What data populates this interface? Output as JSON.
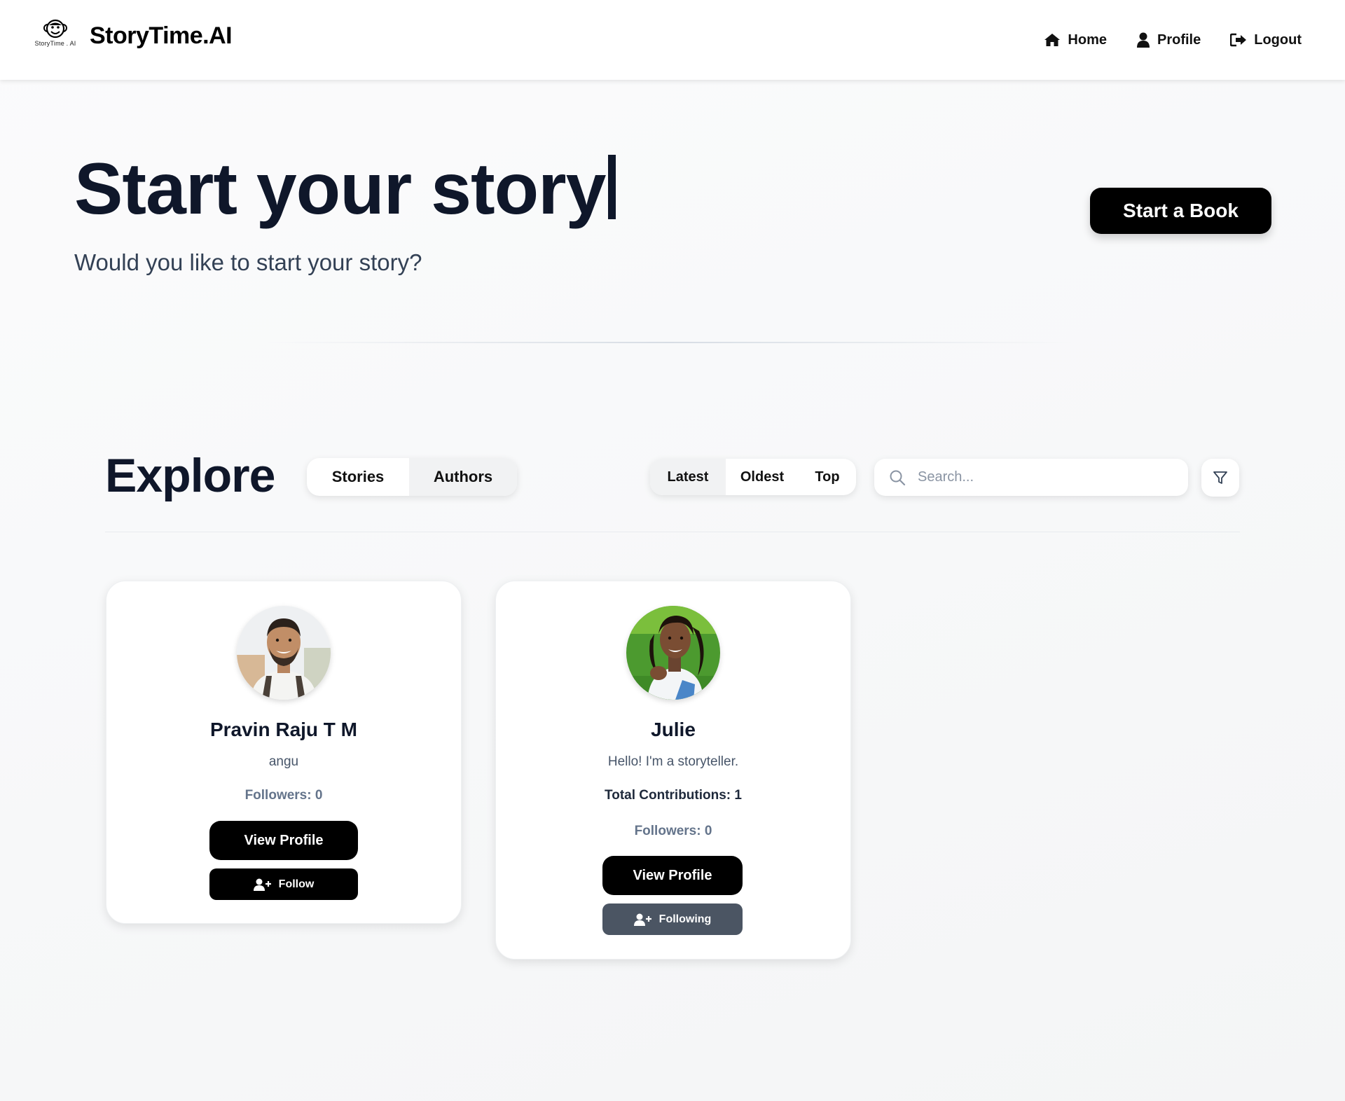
{
  "header": {
    "logo_caption": "StoryTime . AI",
    "brand": "StoryTime.AI",
    "nav": [
      {
        "label": "Home",
        "icon": "home-icon"
      },
      {
        "label": "Profile",
        "icon": "user-icon"
      },
      {
        "label": "Logout",
        "icon": "logout-icon"
      }
    ]
  },
  "hero": {
    "title": "Start your story",
    "subtitle": "Would you like to start your story?",
    "cta": "Start a Book"
  },
  "explore": {
    "title": "Explore",
    "type_tabs": [
      {
        "label": "Stories",
        "active": false
      },
      {
        "label": "Authors",
        "active": true
      }
    ],
    "sort_tabs": [
      {
        "label": "Latest",
        "active": true
      },
      {
        "label": "Oldest",
        "active": false
      },
      {
        "label": "Top",
        "active": false
      }
    ],
    "search_placeholder": "Search...",
    "filter_icon": "filter-icon"
  },
  "authors": [
    {
      "name": "Pravin Raju T M",
      "bio": "angu",
      "followers": "Followers: 0",
      "view_label": "View Profile",
      "follow_label": "Follow"
    },
    {
      "name": "Julie",
      "bio": "Hello! I'm a storyteller.",
      "contributions": "Total Contributions: 1",
      "followers": "Followers: 0",
      "view_label": "View Profile",
      "follow_label": "Following"
    }
  ],
  "colors": {
    "primary": "#000000",
    "heading": "#0f172a",
    "following_button": "#4b5563",
    "active_tab_bg": "#f1f2f3"
  }
}
